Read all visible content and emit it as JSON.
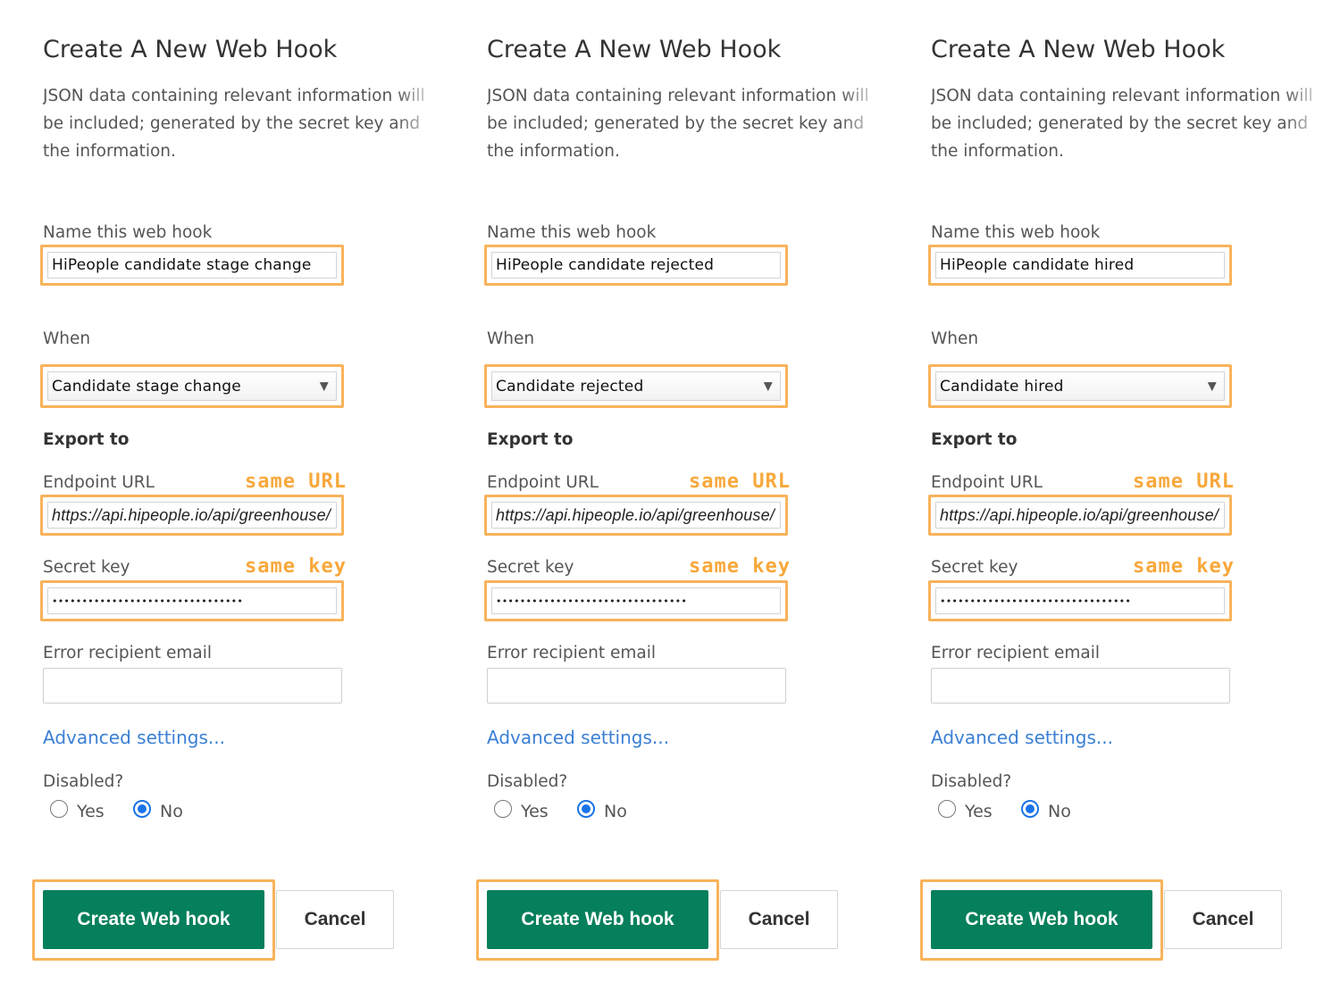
{
  "colors": {
    "accent_highlight": "#f8b35a",
    "annotation": "#f8a83b",
    "primary_button": "#067f5c",
    "link": "#3a7fd5",
    "radio_checked": "#1a73e8"
  },
  "icons": {
    "select_caret": "chevron-down-icon"
  },
  "panels": [
    {
      "title": "Create A New Web Hook",
      "description": "JSON data containing relevant information will be included; generated by the secret key and the information.",
      "name_label": "Name this web hook",
      "name_value": "HiPeople candidate stage change",
      "when_label": "When",
      "when_value": "Candidate stage change",
      "export_label": "Export to",
      "endpoint_label": "Endpoint URL",
      "endpoint_annotation": "same URL",
      "endpoint_value": "https://api.hipeople.io/api/greenhouse/",
      "secret_label": "Secret key",
      "secret_annotation": "same key",
      "secret_value": "••••••••••••••••••••••••••••••••",
      "error_label": "Error recipient email",
      "error_value": "",
      "advanced_link": "Advanced settings...",
      "disabled_label": "Disabled?",
      "yes_label": "Yes",
      "no_label": "No",
      "disabled_selected": "No",
      "create_button": "Create Web hook",
      "cancel_button": "Cancel"
    },
    {
      "title": "Create A New Web Hook",
      "description": "JSON data containing relevant information will be included; generated by the secret key and the information.",
      "name_label": "Name this web hook",
      "name_value": "HiPeople candidate rejected",
      "when_label": "When",
      "when_value": "Candidate rejected",
      "export_label": "Export to",
      "endpoint_label": "Endpoint URL",
      "endpoint_annotation": "same URL",
      "endpoint_value": "https://api.hipeople.io/api/greenhouse/",
      "secret_label": "Secret key",
      "secret_annotation": "same key",
      "secret_value": "••••••••••••••••••••••••••••••••",
      "error_label": "Error recipient email",
      "error_value": "",
      "advanced_link": "Advanced settings...",
      "disabled_label": "Disabled?",
      "yes_label": "Yes",
      "no_label": "No",
      "disabled_selected": "No",
      "create_button": "Create Web hook",
      "cancel_button": "Cancel"
    },
    {
      "title": "Create A New Web Hook",
      "description": "JSON data containing relevant information will be included; generated by the secret key and the information.",
      "name_label": "Name this web hook",
      "name_value": "HiPeople candidate hired",
      "when_label": "When",
      "when_value": "Candidate hired",
      "export_label": "Export to",
      "endpoint_label": "Endpoint URL",
      "endpoint_annotation": "same URL",
      "endpoint_value": "https://api.hipeople.io/api/greenhouse/",
      "secret_label": "Secret key",
      "secret_annotation": "same key",
      "secret_value": "••••••••••••••••••••••••••••••••",
      "error_label": "Error recipient email",
      "error_value": "",
      "advanced_link": "Advanced settings...",
      "disabled_label": "Disabled?",
      "yes_label": "Yes",
      "no_label": "No",
      "disabled_selected": "No",
      "create_button": "Create Web hook",
      "cancel_button": "Cancel"
    }
  ]
}
